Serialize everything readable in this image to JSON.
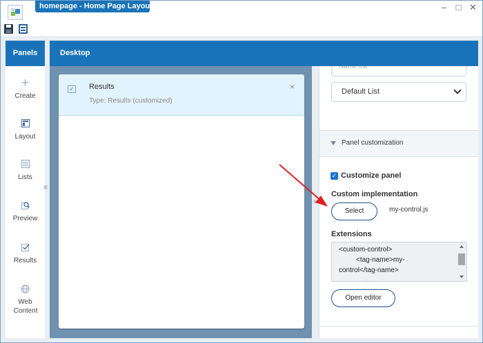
{
  "window": {
    "title": "homepage - Home Page Layout",
    "controls": [
      "minimize-icon",
      "maximize-icon",
      "close-icon"
    ],
    "accent_color": "#1a73b8"
  },
  "toolbar": {
    "icons": [
      "save-icon",
      "layout-icon"
    ]
  },
  "panels": {
    "header": "Panels",
    "items": [
      {
        "label": "Create",
        "icon": "plus-icon"
      },
      {
        "label": "Layout",
        "icon": "layout-icon"
      },
      {
        "label": "Lists",
        "icon": "list-icon"
      },
      {
        "label": "Preview",
        "icon": "preview-icon"
      },
      {
        "label": "Results",
        "icon": "checkbox-icon"
      },
      {
        "label": "Web Content",
        "icon": "globe-icon"
      }
    ]
  },
  "desktop": {
    "header": "Desktop",
    "card": {
      "title": "Results",
      "type": "Type: Results (customized)",
      "close": "×"
    }
  },
  "properties": {
    "partial_input": "Name list",
    "select_value": "Default List",
    "section_title": "Panel customization",
    "customize_panel": {
      "label": "Customize panel",
      "checked": true
    },
    "custom_impl_label": "Custom implementation",
    "select_button": "Select",
    "filename": "my-control.js",
    "extensions_label": "Extensions",
    "extensions_lines": [
      "<custom-control>",
      "<tag-name>my-",
      "control</tag-name>",
      "..."
    ],
    "open_editor_button": "Open editor"
  },
  "annotation": {
    "arrow_color": "#e02020"
  }
}
